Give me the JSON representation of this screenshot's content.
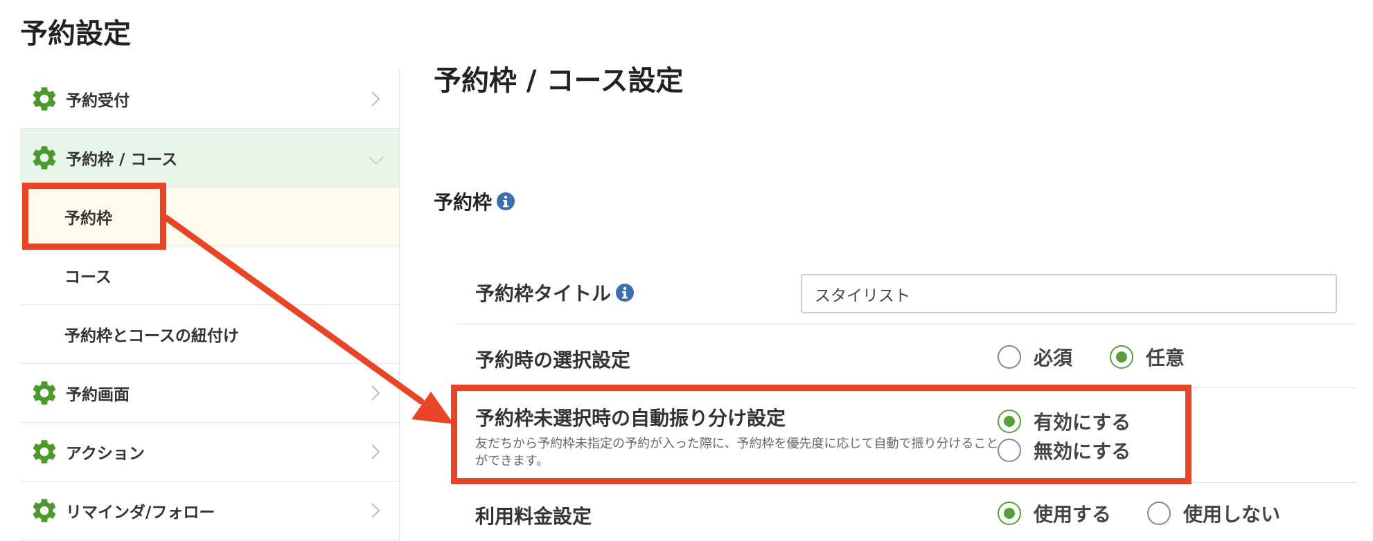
{
  "page": {
    "title": "予約設定"
  },
  "sidebar": {
    "items": [
      {
        "label": "予約受付",
        "kind": "parent",
        "expanded": false
      },
      {
        "label": "予約枠 / コース",
        "kind": "parent",
        "expanded": true
      },
      {
        "label": "予約枠",
        "kind": "child",
        "active": true
      },
      {
        "label": "コース",
        "kind": "child",
        "active": false
      },
      {
        "label": "予約枠とコースの紐付け",
        "kind": "child",
        "active": false
      },
      {
        "label": "予約画面",
        "kind": "parent",
        "expanded": false
      },
      {
        "label": "アクション",
        "kind": "parent",
        "expanded": false
      },
      {
        "label": "リマインダ/フォロー",
        "kind": "parent",
        "expanded": false
      }
    ]
  },
  "main": {
    "title": "予約枠 / コース設定",
    "section_title": "予約枠",
    "rows": {
      "slot_title": {
        "label": "予約枠タイトル",
        "value": "スタイリスト"
      },
      "selection": {
        "label": "予約時の選択設定",
        "options": [
          "必須",
          "任意"
        ],
        "selected": "任意"
      },
      "auto_assign": {
        "label": "予約枠未選択時の自動振り分け設定",
        "description": "友だちから予約枠未指定の予約が入った際に、予約枠を優先度に応じて自動で振り分けることができます。",
        "options": [
          "有効にする",
          "無効にする"
        ],
        "selected": "有効にする"
      },
      "fee": {
        "label": "利用料金設定",
        "options": [
          "使用する",
          "使用しない"
        ],
        "selected": "使用する"
      }
    }
  },
  "colors": {
    "accent_green": "#5a9e3a",
    "gear_green": "#4a9a2c",
    "info_blue": "#3d6fb0",
    "annotation_red": "#e84526",
    "expanded_bg": "#e9f4ea",
    "active_bg": "#fefbec"
  },
  "icons": {
    "menu": "gear-icon",
    "info": "info-icon",
    "collapsed": "chevron-right-icon",
    "expanded": "chevron-down-icon"
  }
}
